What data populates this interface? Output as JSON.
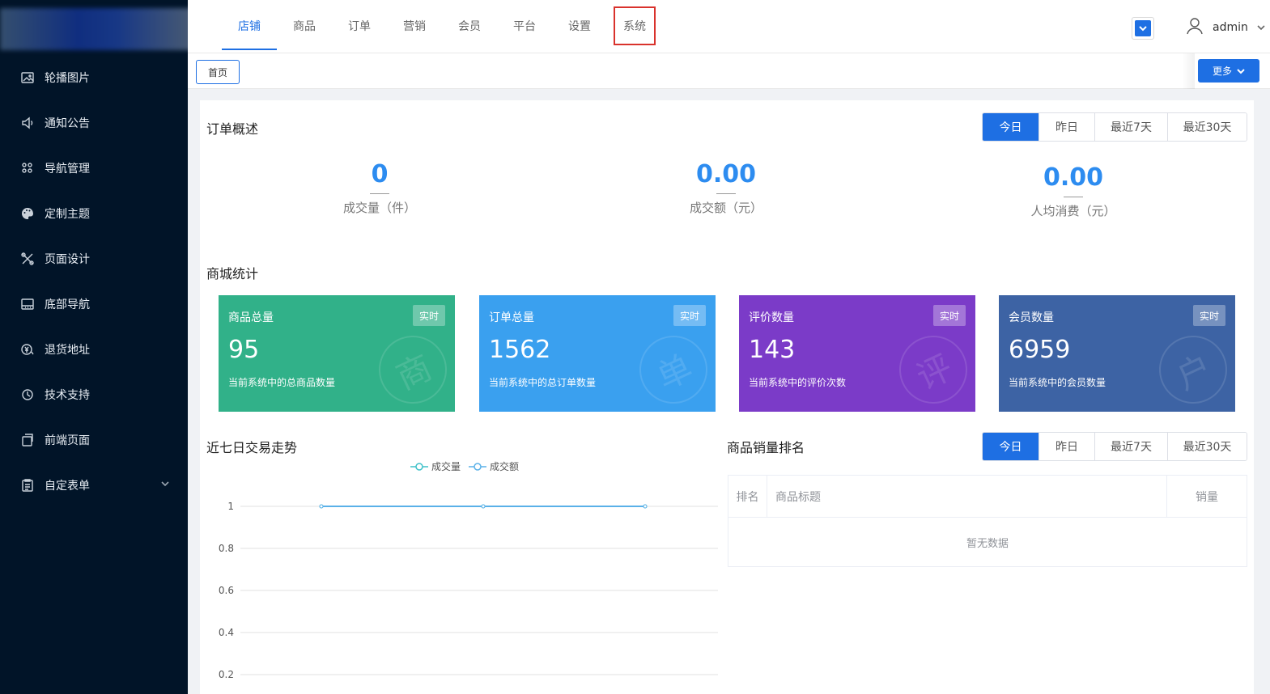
{
  "sidebar": {
    "items": [
      {
        "label": "轮播图片",
        "icon": "image-icon"
      },
      {
        "label": "通知公告",
        "icon": "speaker-icon"
      },
      {
        "label": "导航管理",
        "icon": "grid-icon"
      },
      {
        "label": "定制主题",
        "icon": "palette-icon"
      },
      {
        "label": "页面设计",
        "icon": "tools-icon"
      },
      {
        "label": "底部导航",
        "icon": "bottom-bar-icon"
      },
      {
        "label": "退货地址",
        "icon": "yen-icon"
      },
      {
        "label": "技术支持",
        "icon": "support-icon"
      },
      {
        "label": "前端页面",
        "icon": "pages-icon"
      },
      {
        "label": "自定表单",
        "icon": "form-icon"
      }
    ]
  },
  "header": {
    "tabs": [
      "店铺",
      "商品",
      "订单",
      "营销",
      "会员",
      "平台",
      "设置",
      "系统"
    ],
    "active_tab": "店铺",
    "highlighted_tab": "系统",
    "user_name": "admin"
  },
  "tagbar": {
    "home_label": "首页",
    "more_label": "更多"
  },
  "order_overview": {
    "title": "订单概述",
    "filters": [
      "今日",
      "昨日",
      "最近7天",
      "最近30天"
    ],
    "active_filter": "今日",
    "items": [
      {
        "value": "0",
        "label": "成交量（件）"
      },
      {
        "value": "0.00",
        "label": "成交额（元）"
      },
      {
        "value": "0.00",
        "label": "人均消费（元）"
      }
    ]
  },
  "mall_stats": {
    "title": "商城统计",
    "cards": [
      {
        "title": "商品总量",
        "badge": "实时",
        "value": "95",
        "desc": "当前系统中的总商品数量",
        "mark": "商",
        "color": "#31b189"
      },
      {
        "title": "订单总量",
        "badge": "实时",
        "value": "1562",
        "desc": "当前系统中的总订单数量",
        "mark": "单",
        "color": "#3aa0ef"
      },
      {
        "title": "评价数量",
        "badge": "实时",
        "value": "143",
        "desc": "当前系统中的评价次数",
        "mark": "评",
        "color": "#7b3bc8"
      },
      {
        "title": "会员数量",
        "badge": "实时",
        "value": "6959",
        "desc": "当前系统中的会员数量",
        "mark": "户",
        "color": "#3d63a4"
      }
    ]
  },
  "trend": {
    "title": "近七日交易走势"
  },
  "chart_data": {
    "type": "line",
    "title": "近七日交易走势",
    "series": [
      {
        "name": "成交量",
        "color": "#3fc1c9",
        "values": [
          1,
          1,
          1
        ]
      },
      {
        "name": "成交额",
        "color": "#5ab1e8",
        "values": [
          1,
          1,
          1
        ]
      }
    ],
    "y_ticks": [
      "1",
      "0.8",
      "0.6",
      "0.4",
      "0.2"
    ],
    "ylim": [
      0,
      1
    ],
    "legend": "top",
    "grid": true
  },
  "ranking": {
    "title": "商品销量排名",
    "filters": [
      "今日",
      "昨日",
      "最近7天",
      "最近30天"
    ],
    "active_filter": "今日",
    "columns": [
      "排名",
      "商品标题",
      "销量"
    ],
    "empty_text": "暂无数据"
  }
}
